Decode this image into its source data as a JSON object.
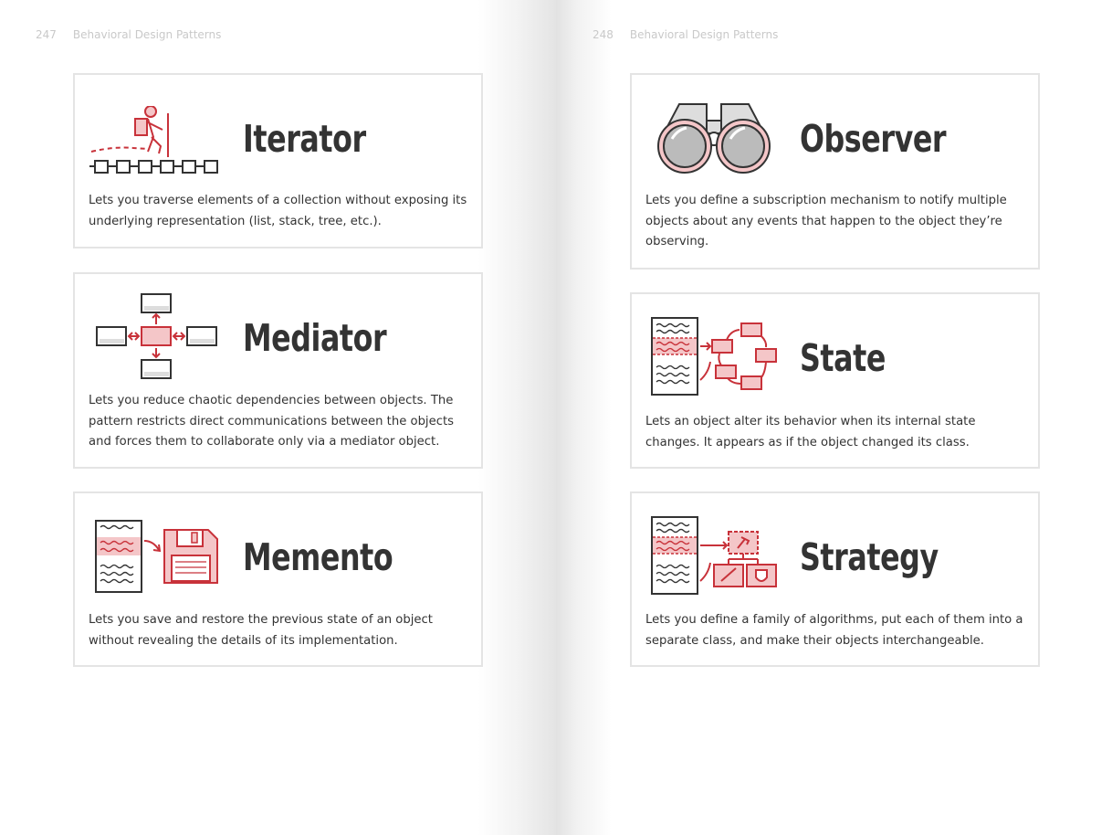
{
  "pages": [
    {
      "number": "247",
      "header": "Behavioral Design Patterns",
      "cards": [
        {
          "title": "Iterator",
          "description": "Lets you traverse elements of a collection without exposing its underlying representation (list, stack, tree, etc.)."
        },
        {
          "title": "Mediator",
          "description": "Lets you reduce chaotic dependencies between objects. The pat­tern restricts direct communications between the objects and forces them to collaborate only via a mediator object."
        },
        {
          "title": "Memento",
          "description": "Lets you save and restore the previous state of an object without revealing the details of its implementation."
        }
      ]
    },
    {
      "number": "248",
      "header": "Behavioral Design Patterns",
      "cards": [
        {
          "title": "Observer",
          "description": "Lets you define a subscription mechanism to notify multiple objects about any events that happen to the object they’re observing."
        },
        {
          "title": "State",
          "description": "Lets an object alter its behavior when its internal state changes. It appears as if the object changed its class."
        },
        {
          "title": "Strategy",
          "description": "Lets you define a family of algorithms, put each of them into a separate class, and make their objects interchangeable."
        }
      ]
    }
  ],
  "colors": {
    "accent": "#c8323a",
    "accent_fill": "#f4c6c8",
    "ink": "#333333",
    "border": "#e4e4e4",
    "header": "#c9c9c9"
  },
  "icons": [
    "hiker-on-chain-icon",
    "mediator-hub-icon",
    "memento-floppy-icon",
    "binoculars-icon",
    "state-graph-icon",
    "strategy-tree-icon"
  ]
}
